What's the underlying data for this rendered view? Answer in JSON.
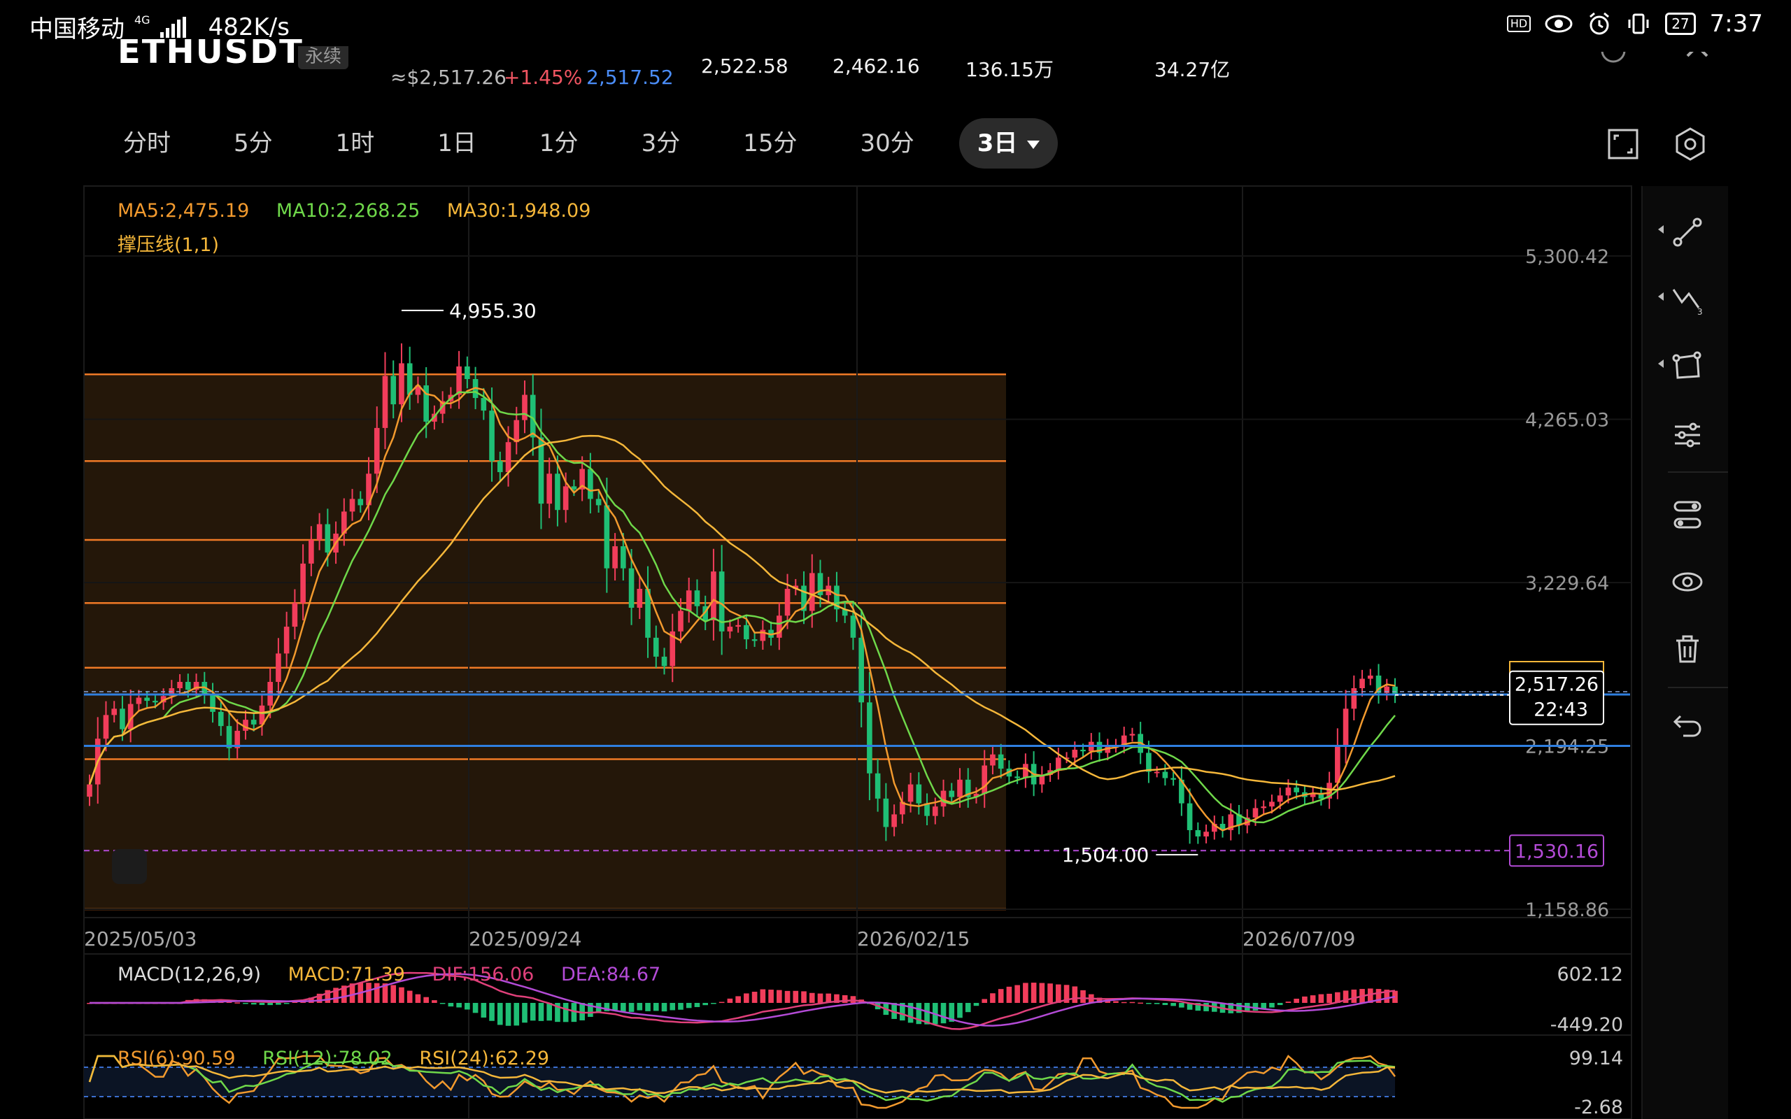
{
  "status_bar": {
    "carrier": "中国移动",
    "network": "4G",
    "speed": "482K/s",
    "hd": "HD",
    "battery": "27",
    "time": "7:37"
  },
  "ticker": {
    "symbol": "ETHUSDT",
    "type": "永续",
    "approx_usd": "≈$2,517.26",
    "change_pct": "+1.45%",
    "mark_price": "2,517.52",
    "high_24h": "2,522.58",
    "low_24h": "2,462.16",
    "volume_24h": "136.15万",
    "turnover_24h": "34.27亿"
  },
  "timeframes": [
    "分时",
    "5分",
    "1时",
    "1日",
    "1分",
    "3分",
    "15分",
    "30分",
    "3日"
  ],
  "timeframe_active": "3日",
  "colors": {
    "up": "#f23d5b",
    "down": "#1fbf75",
    "ma5": "#f29a2e",
    "ma10": "#6fd84a",
    "ma30": "#f5b73a",
    "fib": "#f07a26",
    "blue_line": "#2f7fe0",
    "purple": "#b34bd6"
  },
  "legend": {
    "ma5": "MA5:2,475.19",
    "ma10": "MA10:2,268.25",
    "ma30": "MA30:1,948.09",
    "support": "撑压线(1,1)"
  },
  "markers": {
    "high": "4,955.30",
    "low": "1,504.00",
    "current_price": "2,517.26",
    "countdown": "22:43",
    "purple_level": "1,530.16"
  },
  "macd_legend": {
    "name": "MACD(12,26,9)",
    "macd": "MACD:71.39",
    "dif": "DIF:156.06",
    "dea": "DEA:84.67",
    "top": "602.12",
    "bottom": "-449.20"
  },
  "rsi_legend": {
    "r6": "RSI(6):90.59",
    "r12": "RSI(12):78.02",
    "r24": "RSI(24):62.29",
    "top": "99.14",
    "bottom": "-2.68"
  },
  "chart_data": {
    "type": "candlestick",
    "y_ticks": [
      "5,300.42",
      "4,265.03",
      "3,229.64",
      "2,194.25",
      "1,158.86"
    ],
    "x_ticks": [
      "2025/05/03",
      "2025/09/24",
      "2026/02/15",
      "2026/07/09"
    ],
    "ylim": [
      1158.86,
      5300.42
    ],
    "fib_levels": [
      4550,
      4000,
      3500,
      3100,
      2690,
      2110,
      1158.86
    ],
    "blue_lines": [
      2520,
      2194
    ],
    "purple_level": 1530.16,
    "close_series": [
      1950,
      2240,
      2390,
      2430,
      2300,
      2460,
      2500,
      2480,
      2470,
      2510,
      2560,
      2600,
      2550,
      2600,
      2520,
      2410,
      2320,
      2180,
      2290,
      2360,
      2330,
      2450,
      2600,
      2780,
      2950,
      3100,
      3350,
      3500,
      3600,
      3420,
      3540,
      3680,
      3760,
      3720,
      3920,
      4210,
      4540,
      4360,
      4620,
      4420,
      4480,
      4250,
      4300,
      4380,
      4420,
      4600,
      4520,
      4400,
      4320,
      4000,
      3930,
      4120,
      4260,
      4420,
      4150,
      3730,
      3920,
      3690,
      3840,
      3820,
      3950,
      3760,
      3720,
      3320,
      3460,
      3320,
      3070,
      3190,
      2880,
      2760,
      2700,
      2920,
      3050,
      3180,
      3080,
      2990,
      3300,
      2920,
      2950,
      2960,
      2870,
      2860,
      2930,
      2880,
      3020,
      3190,
      3210,
      3050,
      3290,
      3150,
      3210,
      3060,
      3020,
      2880,
      2470,
      2020,
      1860,
      1680,
      1760,
      1840,
      1950,
      1830,
      1750,
      1810,
      1910,
      1870,
      1980,
      1870,
      1890,
      2070,
      2140,
      2050,
      2000,
      1990,
      2080,
      1950,
      2010,
      2040,
      2120,
      2120,
      2170,
      2160,
      2220,
      2150,
      2190,
      2200,
      2260,
      2270,
      2150,
      2030,
      2030,
      1990,
      1980,
      1830,
      1660,
      1620,
      1650,
      1700,
      1660,
      1760,
      1690,
      1740,
      1800,
      1810,
      1840,
      1880,
      1930,
      1900,
      1870,
      1890,
      1860,
      1960,
      2190,
      2430,
      2560,
      2620,
      2640,
      2530,
      2570,
      2517
    ]
  }
}
